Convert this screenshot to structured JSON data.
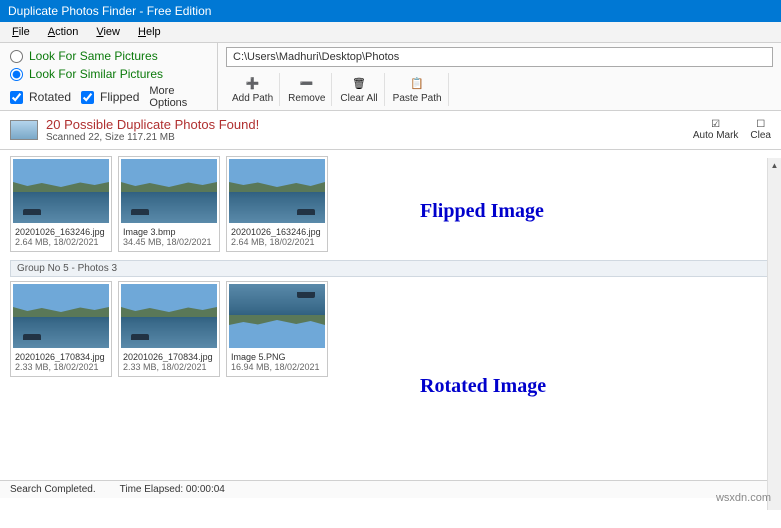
{
  "title": "Duplicate Photos Finder - Free Edition",
  "menu": {
    "file": "File",
    "action": "Action",
    "view": "View",
    "help": "Help"
  },
  "options": {
    "same": "Look For Same Pictures",
    "similar": "Look For Similar Pictures",
    "rotated": "Rotated",
    "flipped": "Flipped",
    "more": "More Options"
  },
  "path": "C:\\Users\\Madhuri\\Desktop\\Photos",
  "toolbar": {
    "add": "Add Path",
    "remove": "Remove",
    "clear": "Clear All",
    "paste": "Paste Path"
  },
  "summary": {
    "headline": "20 Possible Duplicate Photos Found!",
    "sub": "Scanned 22, Size 117.21 MB",
    "automark": "Auto Mark",
    "clearm": "Clea"
  },
  "group1": {
    "thumbs": [
      {
        "fn": "20201026_163246.jpg",
        "meta": "2.64 MB, 18/02/2021"
      },
      {
        "fn": "Image 3.bmp",
        "meta": "34.45 MB, 18/02/2021"
      },
      {
        "fn": "20201026_163246.jpg",
        "meta": "2.64 MB, 18/02/2021"
      }
    ]
  },
  "group2_header": "Group No 5 - Photos 3",
  "group2": {
    "thumbs": [
      {
        "fn": "20201026_170834.jpg",
        "meta": "2.33 MB, 18/02/2021"
      },
      {
        "fn": "20201026_170834.jpg",
        "meta": "2.33 MB, 18/02/2021"
      },
      {
        "fn": "Image 5.PNG",
        "meta": "16.94 MB, 18/02/2021"
      }
    ]
  },
  "annotations": {
    "flipped": "Flipped Image",
    "rotated": "Rotated Image"
  },
  "status": {
    "completed": "Search Completed.",
    "elapsed": "Time Elapsed: 00:00:04"
  },
  "watermark": "wsxdn.com"
}
